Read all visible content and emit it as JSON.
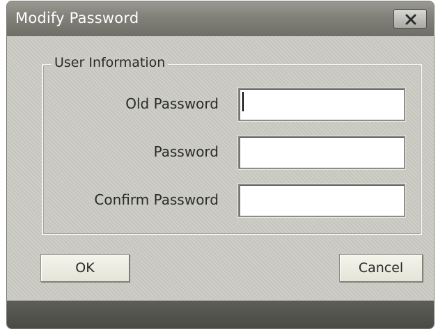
{
  "window": {
    "title": "Modify Password"
  },
  "group": {
    "legend": "User Information"
  },
  "fields": [
    {
      "label": "Old Password",
      "value": "",
      "placeholder": ""
    },
    {
      "label": "Password",
      "value": "",
      "placeholder": ""
    },
    {
      "label": "Confirm Password",
      "value": "",
      "placeholder": ""
    }
  ],
  "buttons": {
    "ok": "OK",
    "cancel": "Cancel"
  },
  "icons": {
    "close": "close-icon"
  },
  "colors": {
    "titlebar": "#818179",
    "body": "#cbcbc4",
    "footer": "#4a4a45",
    "button": "#ecece2"
  }
}
